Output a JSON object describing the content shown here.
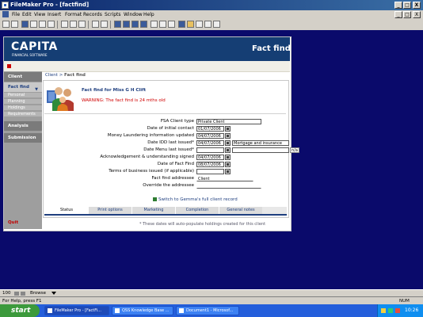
{
  "window": {
    "title": "FileMaker Pro - [factfind]",
    "controls": [
      "_",
      "□",
      "X"
    ],
    "doc_controls": [
      "_",
      "□",
      "X"
    ]
  },
  "menu": [
    "File",
    "Edit",
    "View",
    "Insert",
    "Format",
    "Records",
    "Scripts",
    "Window",
    "Help"
  ],
  "app": {
    "brand": "CAPITA",
    "brand_sub": "FINANCIAL SOFTWARE",
    "section_title": "Fact find"
  },
  "sidebar": {
    "client": "Client",
    "fact_find": "Fact find",
    "fact_find_arrow": "▼",
    "subitems": [
      "Personal",
      "Planning",
      "Holdings",
      "Requirements"
    ],
    "analysis": "Analysis",
    "submission": "Submission",
    "quit": "Quit"
  },
  "breadcrumb": {
    "link": "Client",
    "sep": ">",
    "current": "Fact find"
  },
  "factfind": {
    "heading": "Fact find for Miss G H Clift",
    "warning": "WARNING: The fact find is 24 mths old"
  },
  "form": {
    "rows": [
      {
        "label": "FSA Client type",
        "value": "Private Client"
      },
      {
        "label": "Date of initial contact",
        "value": "01/07/2006"
      },
      {
        "label": "Money Laundering information updated",
        "value": "04/07/2006"
      },
      {
        "label": "Date IDD last issued*",
        "value": "04/07/2006",
        "extra": "Mortgage and insurance"
      },
      {
        "label": "Date Menu last issued*",
        "value": "",
        "extra": "",
        "extra2": "n/a"
      },
      {
        "label": "Acknowledgement & understanding signed",
        "value": "04/07/2006"
      },
      {
        "label": "Date of Fact Find",
        "value": "08/07/2006"
      },
      {
        "label": "Terms of business issued (if applicable)",
        "value": ""
      },
      {
        "label": "Fact find addressee",
        "value": "Client"
      },
      {
        "label": "Override the addressee",
        "value": ""
      }
    ]
  },
  "switch_link": "Switch to Gemma's full client record",
  "tabs": [
    "Status",
    "Print options",
    "Marketing",
    "Completion",
    "General notes"
  ],
  "footnote": "* These dates will auto-populate holdings created for this client",
  "modebar": {
    "zoom": "100",
    "mode": "Browse"
  },
  "statusbar": {
    "help": "For Help, press F1",
    "num": "NUM"
  },
  "taskbar": {
    "start": "start",
    "tasks": [
      "FileMaker Pro - [FactFi...",
      "QSS Knowledge Base ...",
      "Document1 - Microsof..."
    ],
    "clock": "10:26"
  },
  "colors": {
    "header": "#153e74",
    "warning": "#d00000",
    "desktop": "#0a0a6b"
  }
}
